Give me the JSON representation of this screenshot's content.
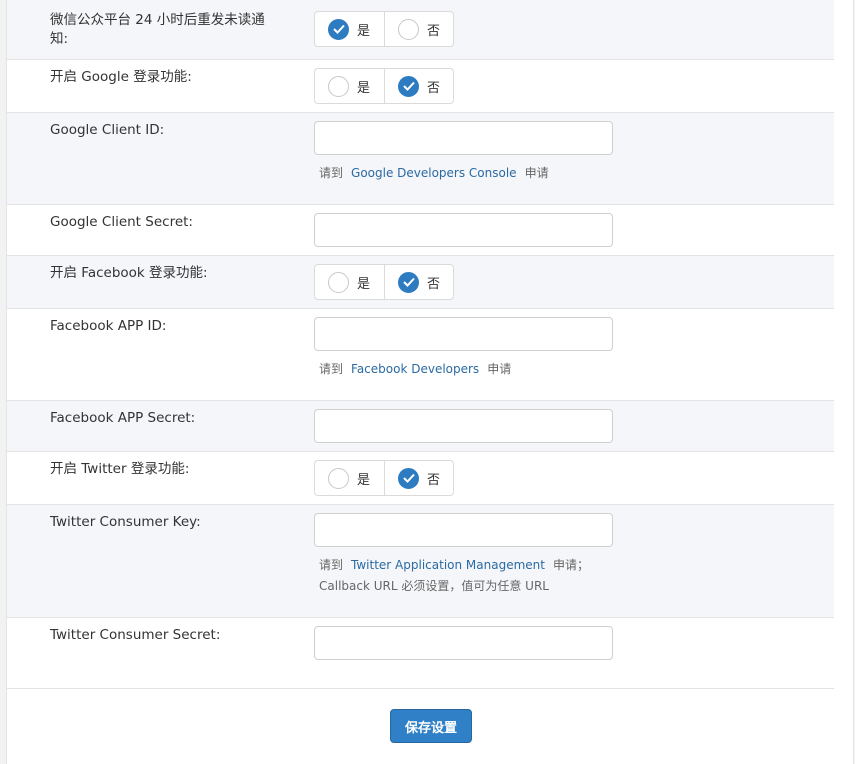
{
  "wechat_notify": {
    "label": "微信公众平台 24 小时后重发未读通知:",
    "yes": "是",
    "no": "否",
    "selected": "yes"
  },
  "google_login": {
    "label": "开启 Google 登录功能:",
    "yes": "是",
    "no": "否",
    "selected": "no"
  },
  "google_client_id": {
    "label": "Google Client ID:",
    "value": "",
    "help_prefix": "请到",
    "help_link": "Google Developers Console",
    "help_suffix": "申请"
  },
  "google_client_secret": {
    "label": "Google Client Secret:",
    "value": ""
  },
  "facebook_login": {
    "label": "开启 Facebook 登录功能:",
    "yes": "是",
    "no": "否",
    "selected": "no"
  },
  "facebook_app_id": {
    "label": "Facebook APP ID:",
    "value": "",
    "help_prefix": "请到",
    "help_link": "Facebook Developers",
    "help_suffix": "申请"
  },
  "facebook_app_secret": {
    "label": "Facebook APP Secret:",
    "value": ""
  },
  "twitter_login": {
    "label": "开启 Twitter 登录功能:",
    "yes": "是",
    "no": "否",
    "selected": "no"
  },
  "twitter_consumer_key": {
    "label": "Twitter Consumer Key:",
    "value": "",
    "help_prefix": "请到",
    "help_link": "Twitter Application Management",
    "help_suffix": "申请；",
    "help_line2": "Callback URL 必须设置，值可为任意 URL"
  },
  "twitter_consumer_secret": {
    "label": "Twitter Consumer Secret:",
    "value": ""
  },
  "save_label": "保存设置",
  "colors": {
    "accent": "#2d7cc1",
    "link": "#2b6aa3",
    "row_shaded": "#f4f6f9"
  }
}
